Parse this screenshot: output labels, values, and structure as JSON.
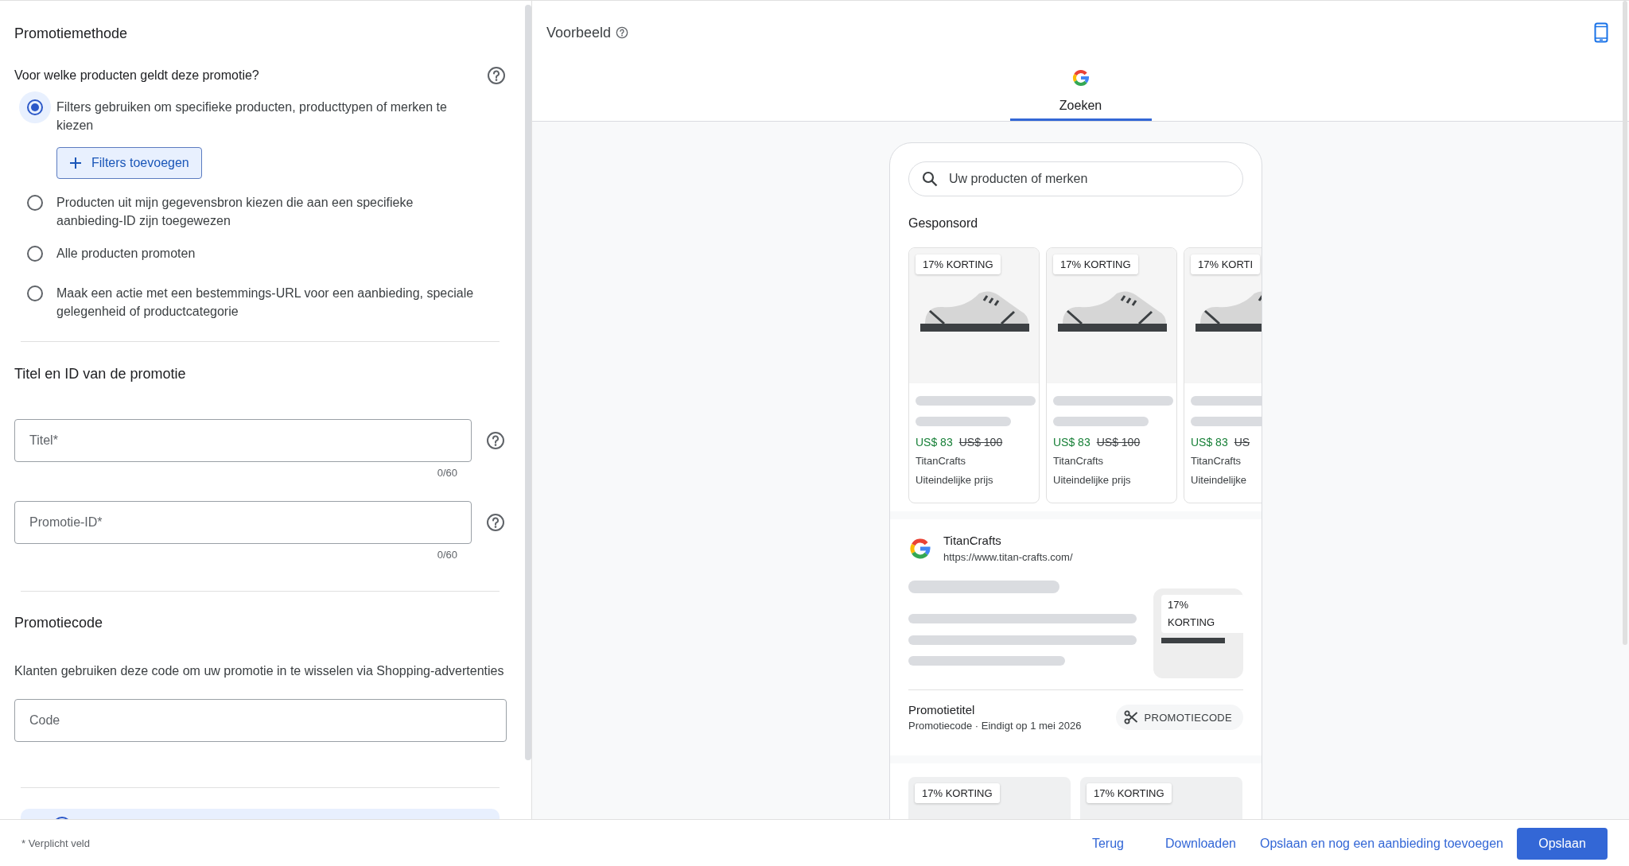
{
  "promotion_method": {
    "title": "Promotiemethode",
    "question": "Voor welke producten geldt deze promotie?",
    "options": [
      {
        "label": "Filters gebruiken om specifieke producten, producttypen of merken te kiezen",
        "selected": true
      },
      {
        "label": "Producten uit mijn gegevensbron kiezen die aan een specifieke aanbieding-ID zijn toegewezen",
        "selected": false
      },
      {
        "label": "Alle producten promoten",
        "selected": false
      },
      {
        "label": "Maak een actie met een bestemmings-URL voor een aanbieding, speciale gelegenheid of productcategorie",
        "selected": false
      }
    ],
    "add_filters_button": "Filters toevoegen"
  },
  "title_and_id": {
    "title": "Titel en ID van de promotie",
    "fields": [
      {
        "placeholder": "Titel*",
        "counter": "0/60"
      },
      {
        "placeholder": "Promotie-ID*",
        "counter": "0/60"
      }
    ]
  },
  "promo_code": {
    "title": "Promotiecode",
    "description": "Klanten gebruiken deze code om uw promotie in te wisselen via Shopping-advertenties",
    "field": {
      "placeholder": "Code"
    }
  },
  "preview": {
    "title": "Voorbeeld",
    "tabs": [
      {
        "label": "Zoeken",
        "selected": true
      }
    ],
    "search": {
      "placeholder": "Uw producten of merken"
    },
    "sponsored_label": "Gesponsord",
    "products": [
      {
        "badge": "17% KORTING",
        "price": "US$ 83",
        "old_price": "US$ 100",
        "brand": "TitanCrafts",
        "note": "Uiteindelijke prijs"
      },
      {
        "badge": "17% KORTING",
        "price": "US$ 83",
        "old_price": "US$ 100",
        "brand": "TitanCrafts",
        "note": "Uiteindelijke prijs"
      },
      {
        "badge": "17% KORTI",
        "price": "US$ 83",
        "old_price": "US",
        "brand": "TitanCrafts",
        "note": "Uiteindelijke"
      }
    ],
    "result": {
      "site": "TitanCrafts",
      "url": "https://www.titan-crafts.com/",
      "thumbnail_badge": "17% KORTING",
      "promo_title": "Promotietitel",
      "promo_meta": "Promotiecode · Eindigt op 1 mei 2026",
      "chip": "PROMOTIECODE"
    },
    "more_products": [
      {
        "badge": "17% KORTING"
      },
      {
        "badge": "17% KORTING"
      }
    ]
  },
  "footer": {
    "required_note": "* Verplicht veld",
    "links": [
      "Terug",
      "Downloaden",
      "Opslaan en nog een aanbieding toevoegen"
    ],
    "primary_button": "Opslaan"
  }
}
